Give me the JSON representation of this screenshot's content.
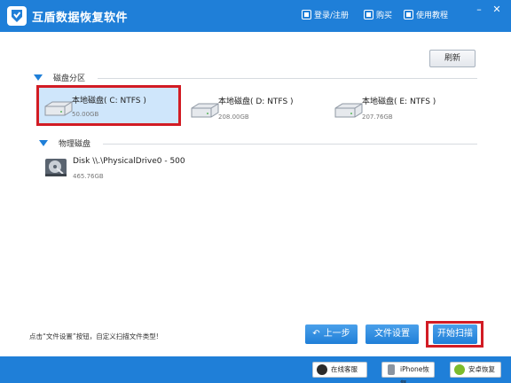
{
  "app": {
    "title": "互盾数据恢复软件"
  },
  "header": {
    "login_label": "登录/注册",
    "buy_label": "购买",
    "tutorial_label": "使用教程"
  },
  "toolbar": {
    "refresh_label": "刷新"
  },
  "partitions": {
    "label": "磁盘分区",
    "items": [
      {
        "name": "本地磁盘( C: NTFS )",
        "size": "50.00GB"
      },
      {
        "name": "本地磁盘( D: NTFS )",
        "size": "208.00GB"
      },
      {
        "name": "本地磁盘( E: NTFS )",
        "size": "207.76GB"
      }
    ]
  },
  "physical": {
    "label": "物理磁盘",
    "items": [
      {
        "name": "Disk \\\\.\\PhysicalDrive0 - 500",
        "size": "465.76GB"
      }
    ]
  },
  "hint": "点击“文件设置”按钮，自定义扫描文件类型!",
  "actions": {
    "prev_label": "上一步",
    "settings_label": "文件设置",
    "scan_label": "开始扫描"
  },
  "footer": {
    "online_service_label": "在线客服",
    "iphone_label": "iPhone恢复",
    "android_label": "安卓恢复"
  },
  "colors": {
    "accent": "#1f7fd8",
    "highlight": "#d21c24",
    "selected_bg": "#cfe6fb"
  },
  "icons": [
    "app-logo-icon",
    "login-icon",
    "cart-icon",
    "tutorial-icon",
    "hdd-icon",
    "physical-disk-icon",
    "back-arrow-icon",
    "qq-icon",
    "iphone-icon",
    "android-icon"
  ]
}
